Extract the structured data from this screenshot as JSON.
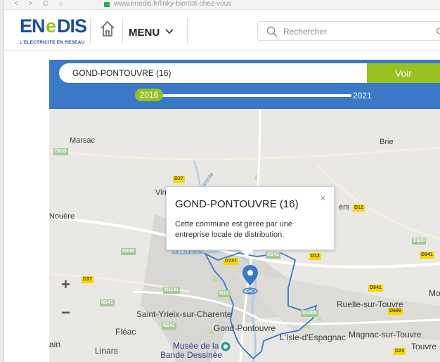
{
  "browser": {
    "url": "www.enedis.fr/linky-bientot-chez-vous",
    "nav_glyphs": "< > C ⌂"
  },
  "header": {
    "logo_text": "ENEDIS",
    "logo_tagline": "L'ELECTRICITE EN RESEAU",
    "menu_label": "MENU",
    "search_placeholder": "Rechercher",
    "search_trailing": "O"
  },
  "panel": {
    "commune_value": "GOND-PONTOUVRE (16)",
    "voir_label": "Voir",
    "timeline": {
      "start_year": "2016",
      "end_year": "2021",
      "progress": 0.0
    }
  },
  "map": {
    "places": {
      "marsac": "Marsac",
      "brie": "Brie",
      "vin": "Vin",
      "ers": "ers",
      "nouere": "Nouère",
      "la_charente": "La Charente",
      "charente_river": "Charente",
      "saint_yrieix": "Saint-Yrieix-sur-Charente",
      "fleac": "Fléac",
      "gond_pontouvre": "Gond-Pontouvre",
      "ruelle": "Ruelle-sur-Touvre",
      "isle_espagnac": "L'Isle-d'Espagnac",
      "magnac": "Magnac-sur-Touvre",
      "touvre": "Touvre",
      "linars": "Linars",
      "musee_1": "Musée de la",
      "musee_2": "Bande Dessinée",
      "mo": "Mo",
      "ain": "ain"
    },
    "roads": {
      "d939_a": "D939",
      "d939_b": "D939",
      "d37_a": "D37",
      "d37_b": "D37",
      "d12_a": "D12",
      "d12_b": "D12",
      "d737": "D737",
      "n141_a": "N141",
      "n141_b": "N141",
      "n141_c": "N141",
      "n1141": "N1141",
      "n10": "N10",
      "e603": "E603",
      "d941_a": "D941",
      "d941_b": "D941",
      "d1000": "D1000",
      "d699": "D699",
      "d23": "D23"
    },
    "zoom_in_label": "+",
    "zoom_out_label": "−",
    "popup": {
      "title": "GOND-PONTOUVRE (16)",
      "close_label": "×",
      "body": "Cette commune est gérée par une entreprise locale de distribution."
    },
    "colors": {
      "boundary": "#3a79c8",
      "river": "#aacbe8",
      "marker": "#3a79c8",
      "accent_green": "#96c11f"
    }
  }
}
